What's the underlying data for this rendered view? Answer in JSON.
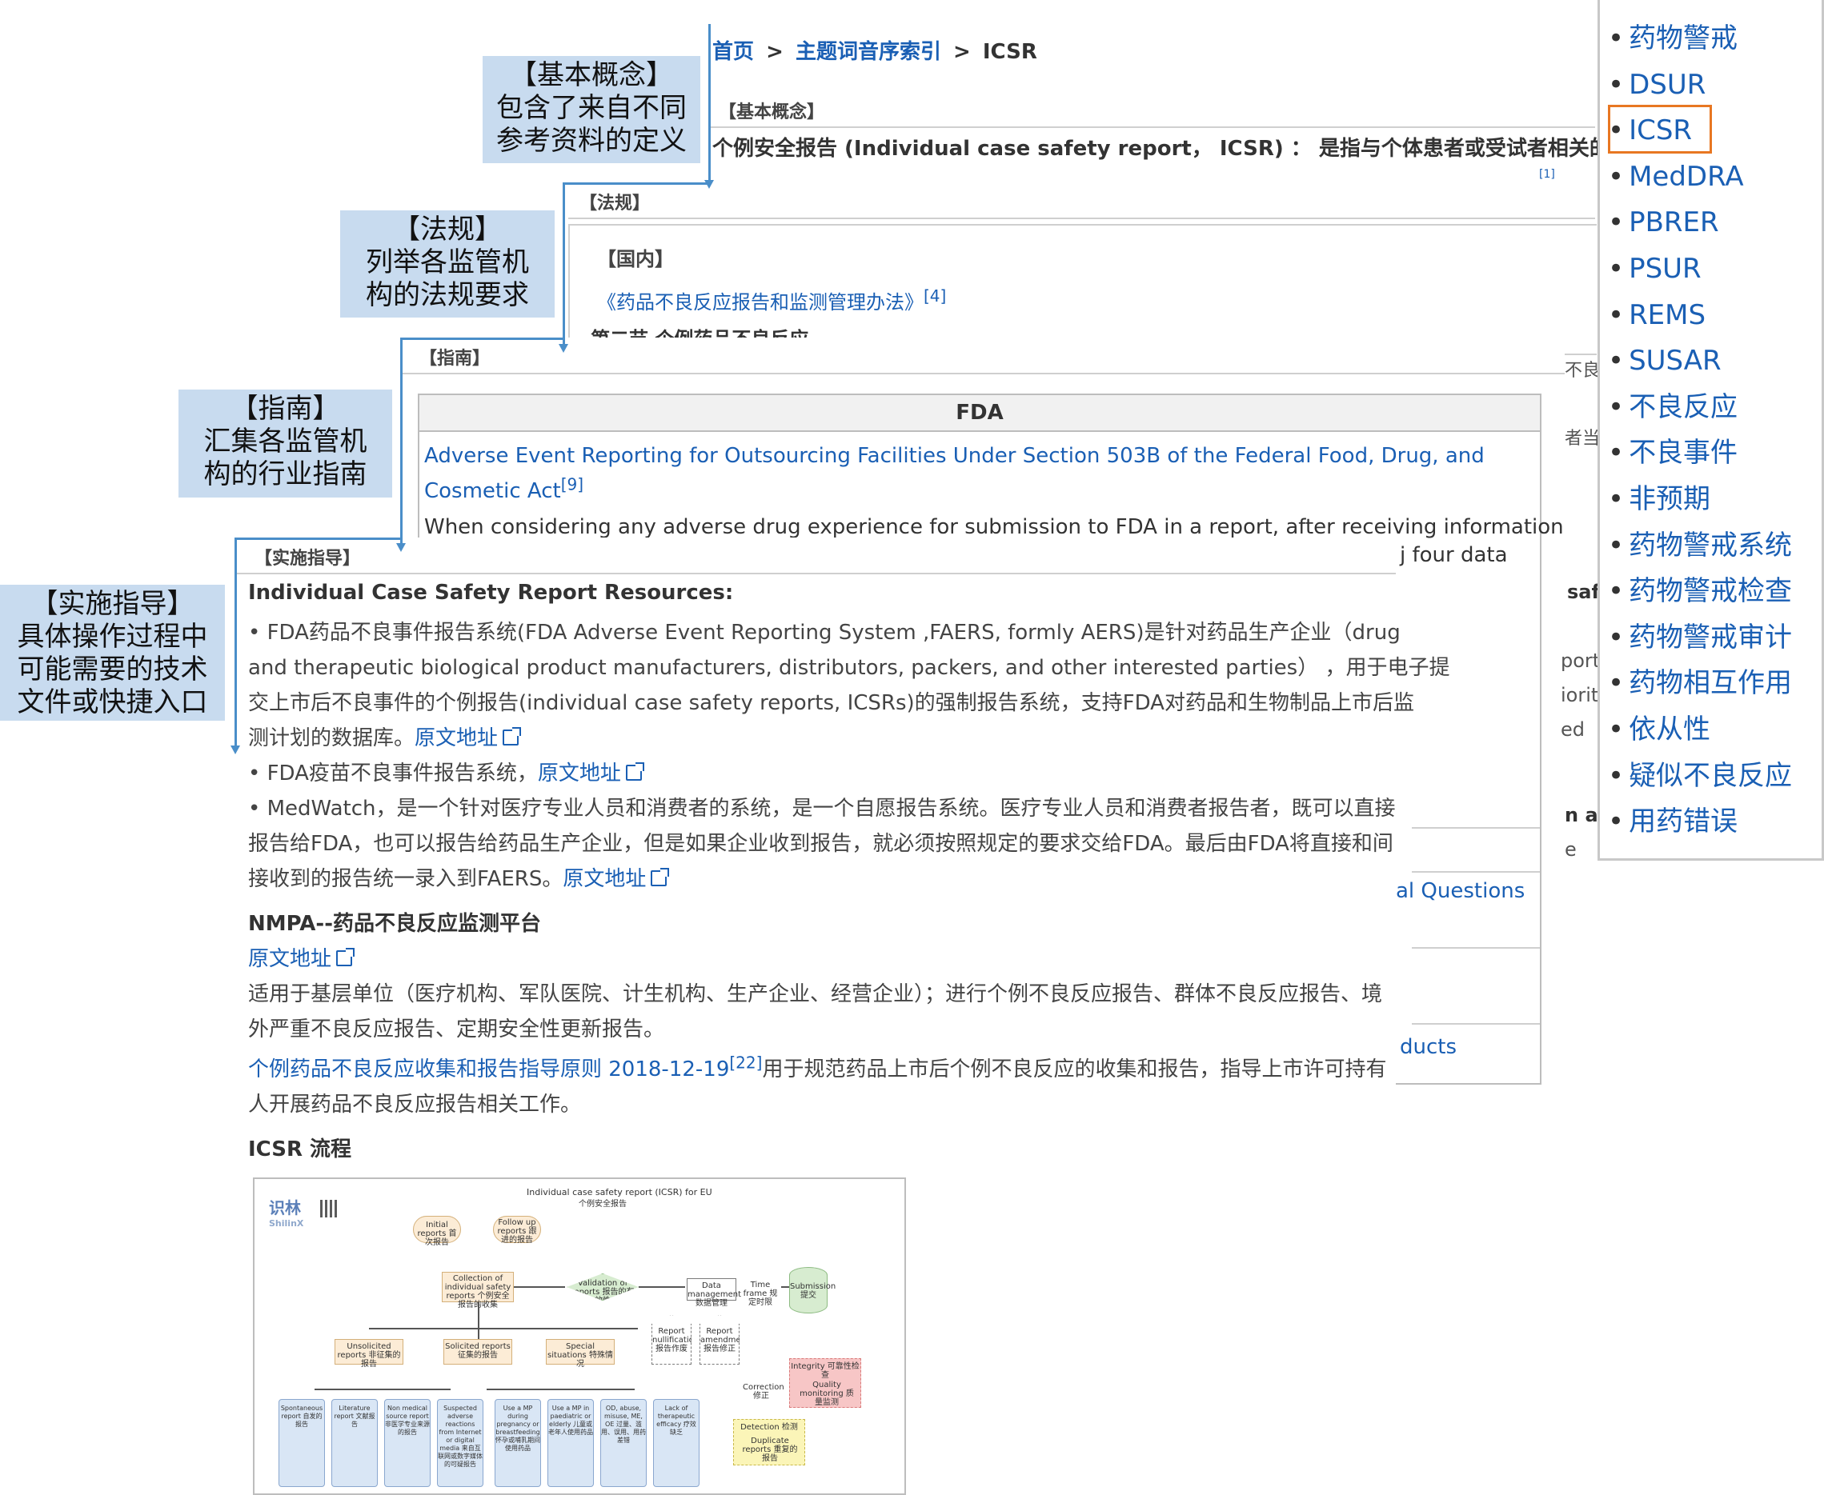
{
  "breadcrumb": {
    "home": "首页",
    "sep1": ">",
    "index": "主题词音序索引",
    "sep2": ">",
    "current": "ICSR"
  },
  "callouts": {
    "concept": "【基本概念】\n包含了来自不同\n参考资料的定义",
    "regulation": "【法规】\n列举各监管机\n构的法规要求",
    "guidance": "【指南】\n汇集各监管机\n构的行业指南",
    "implementation": "【实施指导】\n具体操作过程中\n可能需要的技术\n文件或快捷入口"
  },
  "concept": {
    "header": "【基本概念】",
    "text": "个例安全报告 (Individual case safety report， ICSR) ： 是指与个体患者或受试者相关的不良药物",
    "ref": "[1]"
  },
  "regulation": {
    "header": "【法规】",
    "domestic_header": "【国内】",
    "link": "《药品不良反应报告和监测管理办法》",
    "link_ref": "[4]",
    "section": "第二节 个例药品不良反应",
    "peek1": "不良",
    "peek2": "者当"
  },
  "guidance": {
    "header": "【指南】",
    "fda_header": "FDA",
    "link": "Adverse Event Reporting for Outsourcing Facilities Under Section 503B of the Federal Food, Drug, and Cosmetic Act",
    "link_ref": "[9]",
    "text": "When considering any adverse drug experience for submission to FDA in a report, after receiving information",
    "peek_four_data": "j four data",
    "peek_saf": "saf",
    "peek_port": "port",
    "peek_iorit": "iorit",
    "peek_ed": "ed",
    "peek_n_a": "n a",
    "peek_e": "e",
    "peek_questions": "al Questions",
    "peek_ducts": "ducts"
  },
  "implementation": {
    "header": "【实施指导】",
    "resources_title": "Individual Case Safety Report Resources:",
    "faers_line1": "• FDA药品不良事件报告系统(FDA Adverse Event Reporting System ,FAERS, formly AERS)是针对药品生产企业（drug",
    "faers_line2": "and therapeutic biological product manufacturers, distributors, packers, and other interested parties） ，用于电子提",
    "faers_line3": "交上市后不良事件的个例报告(individual case safety reports, ICSRs)的强制报告系统，支持FDA对药品和生物制品上市后监",
    "faers_line4": "测计划的数据库。",
    "source_link": "原文地址",
    "vaers_text": "• FDA疫苗不良事件报告系统，",
    "medwatch_line1": "• MedWatch，是一个针对医疗专业人员和消费者的系统，是一个自愿报告系统。医疗专业人员和消费者报告者，既可以直接",
    "medwatch_line2": "报告给FDA，也可以报告给药品生产企业，但是如果企业收到报告，就必须按照规定的要求交给FDA。最后由FDA将直接和间",
    "medwatch_line3": "接收到的报告统一录入到FAERS。",
    "nmpa_title": "NMPA--药品不良反应监测平台",
    "nmpa_line1": "适用于基层单位（医疗机构、军队医院、计生机构、生产企业、经营企业）；进行个例不良反应报告、群体不良反应报告、境",
    "nmpa_line2": "外严重不良反应报告、定期安全性更新报告。",
    "principle_link": "个例药品不良反应收集和报告指导原则 2018-12-19",
    "principle_ref": "[22]",
    "principle_line1": "用于规范药品上市后个例不良反应的收集和报告，指导上市许可持有",
    "principle_line2": "人开展药品不良反应报告相关工作。",
    "flow_title": "ICSR 流程"
  },
  "flowchart": {
    "title": "Individual case safety report (ICSR) for EU",
    "subtitle": "个例安全报告",
    "logo": "识林",
    "logo_sub": "ShilinX",
    "initial": "Initial reports 首次报告",
    "followup": "Follow up reports 跟进的报告",
    "collection": "Collection of individual safety reports 个例安全报告的收集",
    "validation": "Validation of reports 报告的有效性",
    "data_mgmt": "Data management 数据管理",
    "time_frame": "Time frame 规定时限",
    "submission": "Submission 提交",
    "unsolicited": "Unsolicited reports 非征集的报告",
    "solicited": "Solicited reports 征集的报告",
    "special": "Special situations 特殊情况",
    "nullification": "Report nullification 报告作废",
    "amendment": "Report amendment 报告修正",
    "integrity": "Integrity 可靠性检查",
    "quality": "Quality monitoring 质量监测",
    "correction": "Correction 修正",
    "detection": "Detection 检测",
    "duplicate": "Duplicate reports 重复的报告",
    "leaves": [
      "Spontaneous report 自发的报告",
      "Literature report 文献报告",
      "Non medical source report 非医学专业来源的报告",
      "Suspected adverse reactions from Internet or digital media 来自互联网或数字媒体的可疑报告",
      "Use a MP during pregnancy or breastfeeding 怀孕或哺乳期间使用药品",
      "Use a MP in paediatric or elderly 儿童或老年人使用药品",
      "OD, abuse, misuse, ME, OE 过量、滥用、误用、用药差错",
      "Lack of therapeutic efficacy 疗效缺乏"
    ]
  },
  "sidebar": {
    "items": [
      "药物警戒",
      "DSUR",
      "ICSR",
      "MedDRA",
      "PBRER",
      "PSUR",
      "REMS",
      "SUSAR",
      "不良反应",
      "不良事件",
      "非预期",
      "药物警戒系统",
      "药物警戒检查",
      "药物警戒审计",
      "药物相互作用",
      "依从性",
      "疑似不良反应",
      "用药错误"
    ],
    "active_index": 2,
    "highlight_color": "#e87722"
  }
}
